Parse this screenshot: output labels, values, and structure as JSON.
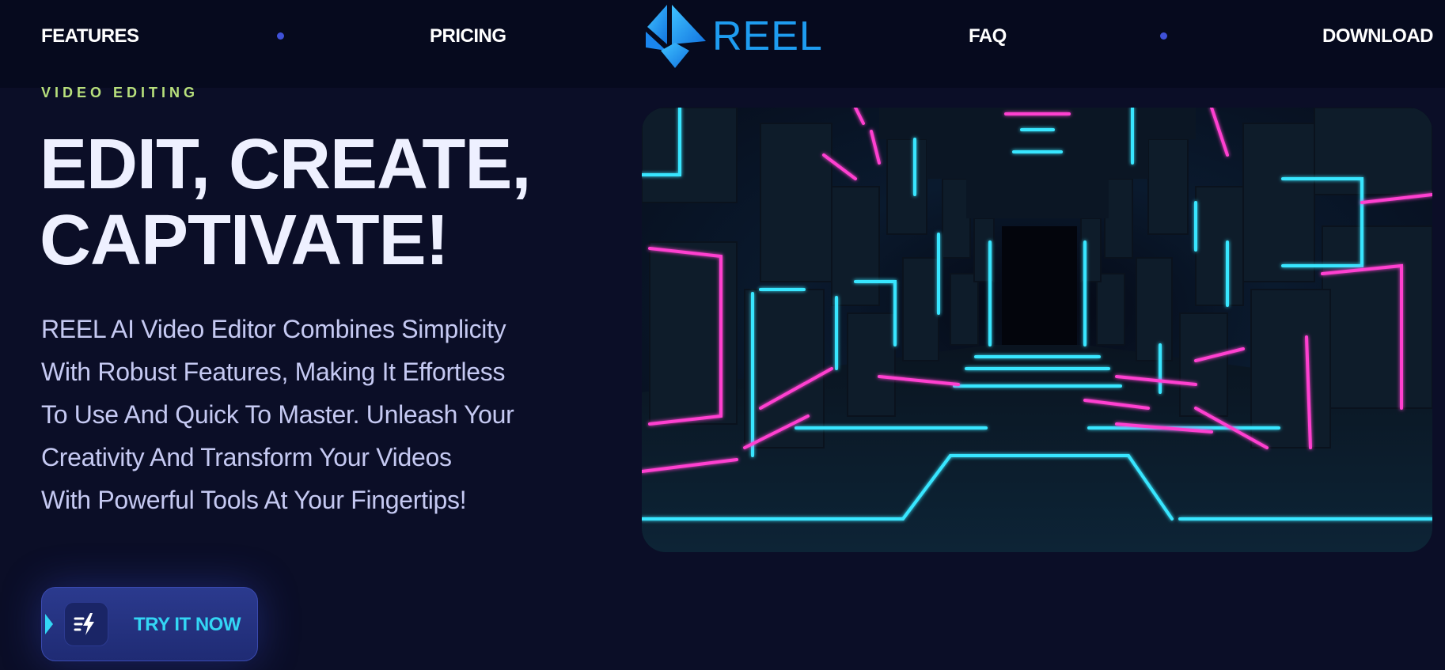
{
  "nav": {
    "features": "FEATURES",
    "pricing": "PRICING",
    "faq": "FAQ",
    "download": "DOWNLOAD"
  },
  "logo": {
    "text": "REEL",
    "icon": "diamond-logo-icon",
    "color": "#1e9cf0"
  },
  "hero": {
    "eyebrow": "VIDEO EDITING",
    "headline_lines": [
      "EDIT, CREATE,",
      "CAPTIVATE!"
    ],
    "description_lines": [
      "REEL AI Video Editor Combines Simplicity",
      "With Robust Features, Making It Effortless",
      "To Use And Quick To Master. Unleash Your",
      "Creativity And Transform Your Videos",
      "With Powerful Tools At Your Fingertips!"
    ],
    "cta_label": "TRY IT NOW",
    "cta_icon": "lightning-speed-icon",
    "image_icon": "neon-corridor-image"
  },
  "colors": {
    "background": "#0b0e27",
    "nav_background": "#060a1e",
    "eyebrow": "#b8e07c",
    "accent_cyan": "#33d6f5",
    "accent_magenta": "#ff3fd0",
    "nav_dot": "#3f51d8"
  }
}
